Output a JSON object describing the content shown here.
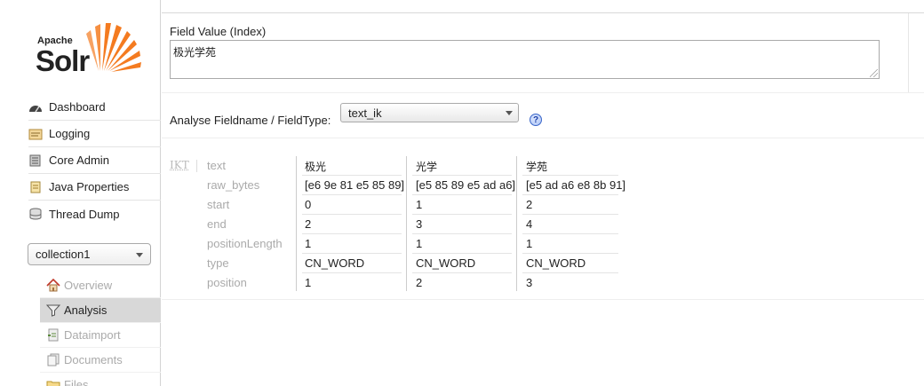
{
  "sidebar": {
    "logo": {
      "apache": "Apache",
      "solr": "Solr"
    },
    "menu": [
      {
        "label": "Dashboard",
        "icon": "dashboard-icon"
      },
      {
        "label": "Logging",
        "icon": "logging-icon"
      },
      {
        "label": "Core Admin",
        "icon": "core-admin-icon"
      },
      {
        "label": "Java Properties",
        "icon": "java-properties-icon"
      },
      {
        "label": "Thread Dump",
        "icon": "thread-dump-icon"
      }
    ],
    "core_selector": {
      "value": "collection1"
    },
    "core_menu": [
      {
        "label": "Overview",
        "icon": "home-icon"
      },
      {
        "label": "Analysis",
        "icon": "funnel-icon",
        "active": true
      },
      {
        "label": "Dataimport",
        "icon": "dataimport-icon"
      },
      {
        "label": "Documents",
        "icon": "documents-icon"
      },
      {
        "label": "Files",
        "icon": "files-icon"
      }
    ]
  },
  "analysis": {
    "field_value_label": "Field Value (Index)",
    "field_value": "极光学苑",
    "fieldtype_label": "Analyse Fieldname / FieldType:",
    "fieldtype_value": "text_ik",
    "help": "?",
    "tokenizer": "IKT",
    "attributes": [
      "text",
      "raw_bytes",
      "start",
      "end",
      "positionLength",
      "type",
      "position"
    ],
    "tokens": [
      {
        "text": "极光",
        "raw_bytes": "[e6 9e 81 e5 85 89]",
        "start": "0",
        "end": "2",
        "positionLength": "1",
        "type": "CN_WORD",
        "position": "1"
      },
      {
        "text": "光学",
        "raw_bytes": "[e5 85 89 e5 ad a6]",
        "start": "1",
        "end": "3",
        "positionLength": "1",
        "type": "CN_WORD",
        "position": "2"
      },
      {
        "text": "学苑",
        "raw_bytes": "[e5 ad a6 e8 8b 91]",
        "start": "2",
        "end": "4",
        "positionLength": "1",
        "type": "CN_WORD",
        "position": "3"
      }
    ]
  },
  "colors": {
    "active_bg": "#d8d8d8",
    "logo_orange": "#f47b20",
    "help_blue": "#3a66c9"
  }
}
